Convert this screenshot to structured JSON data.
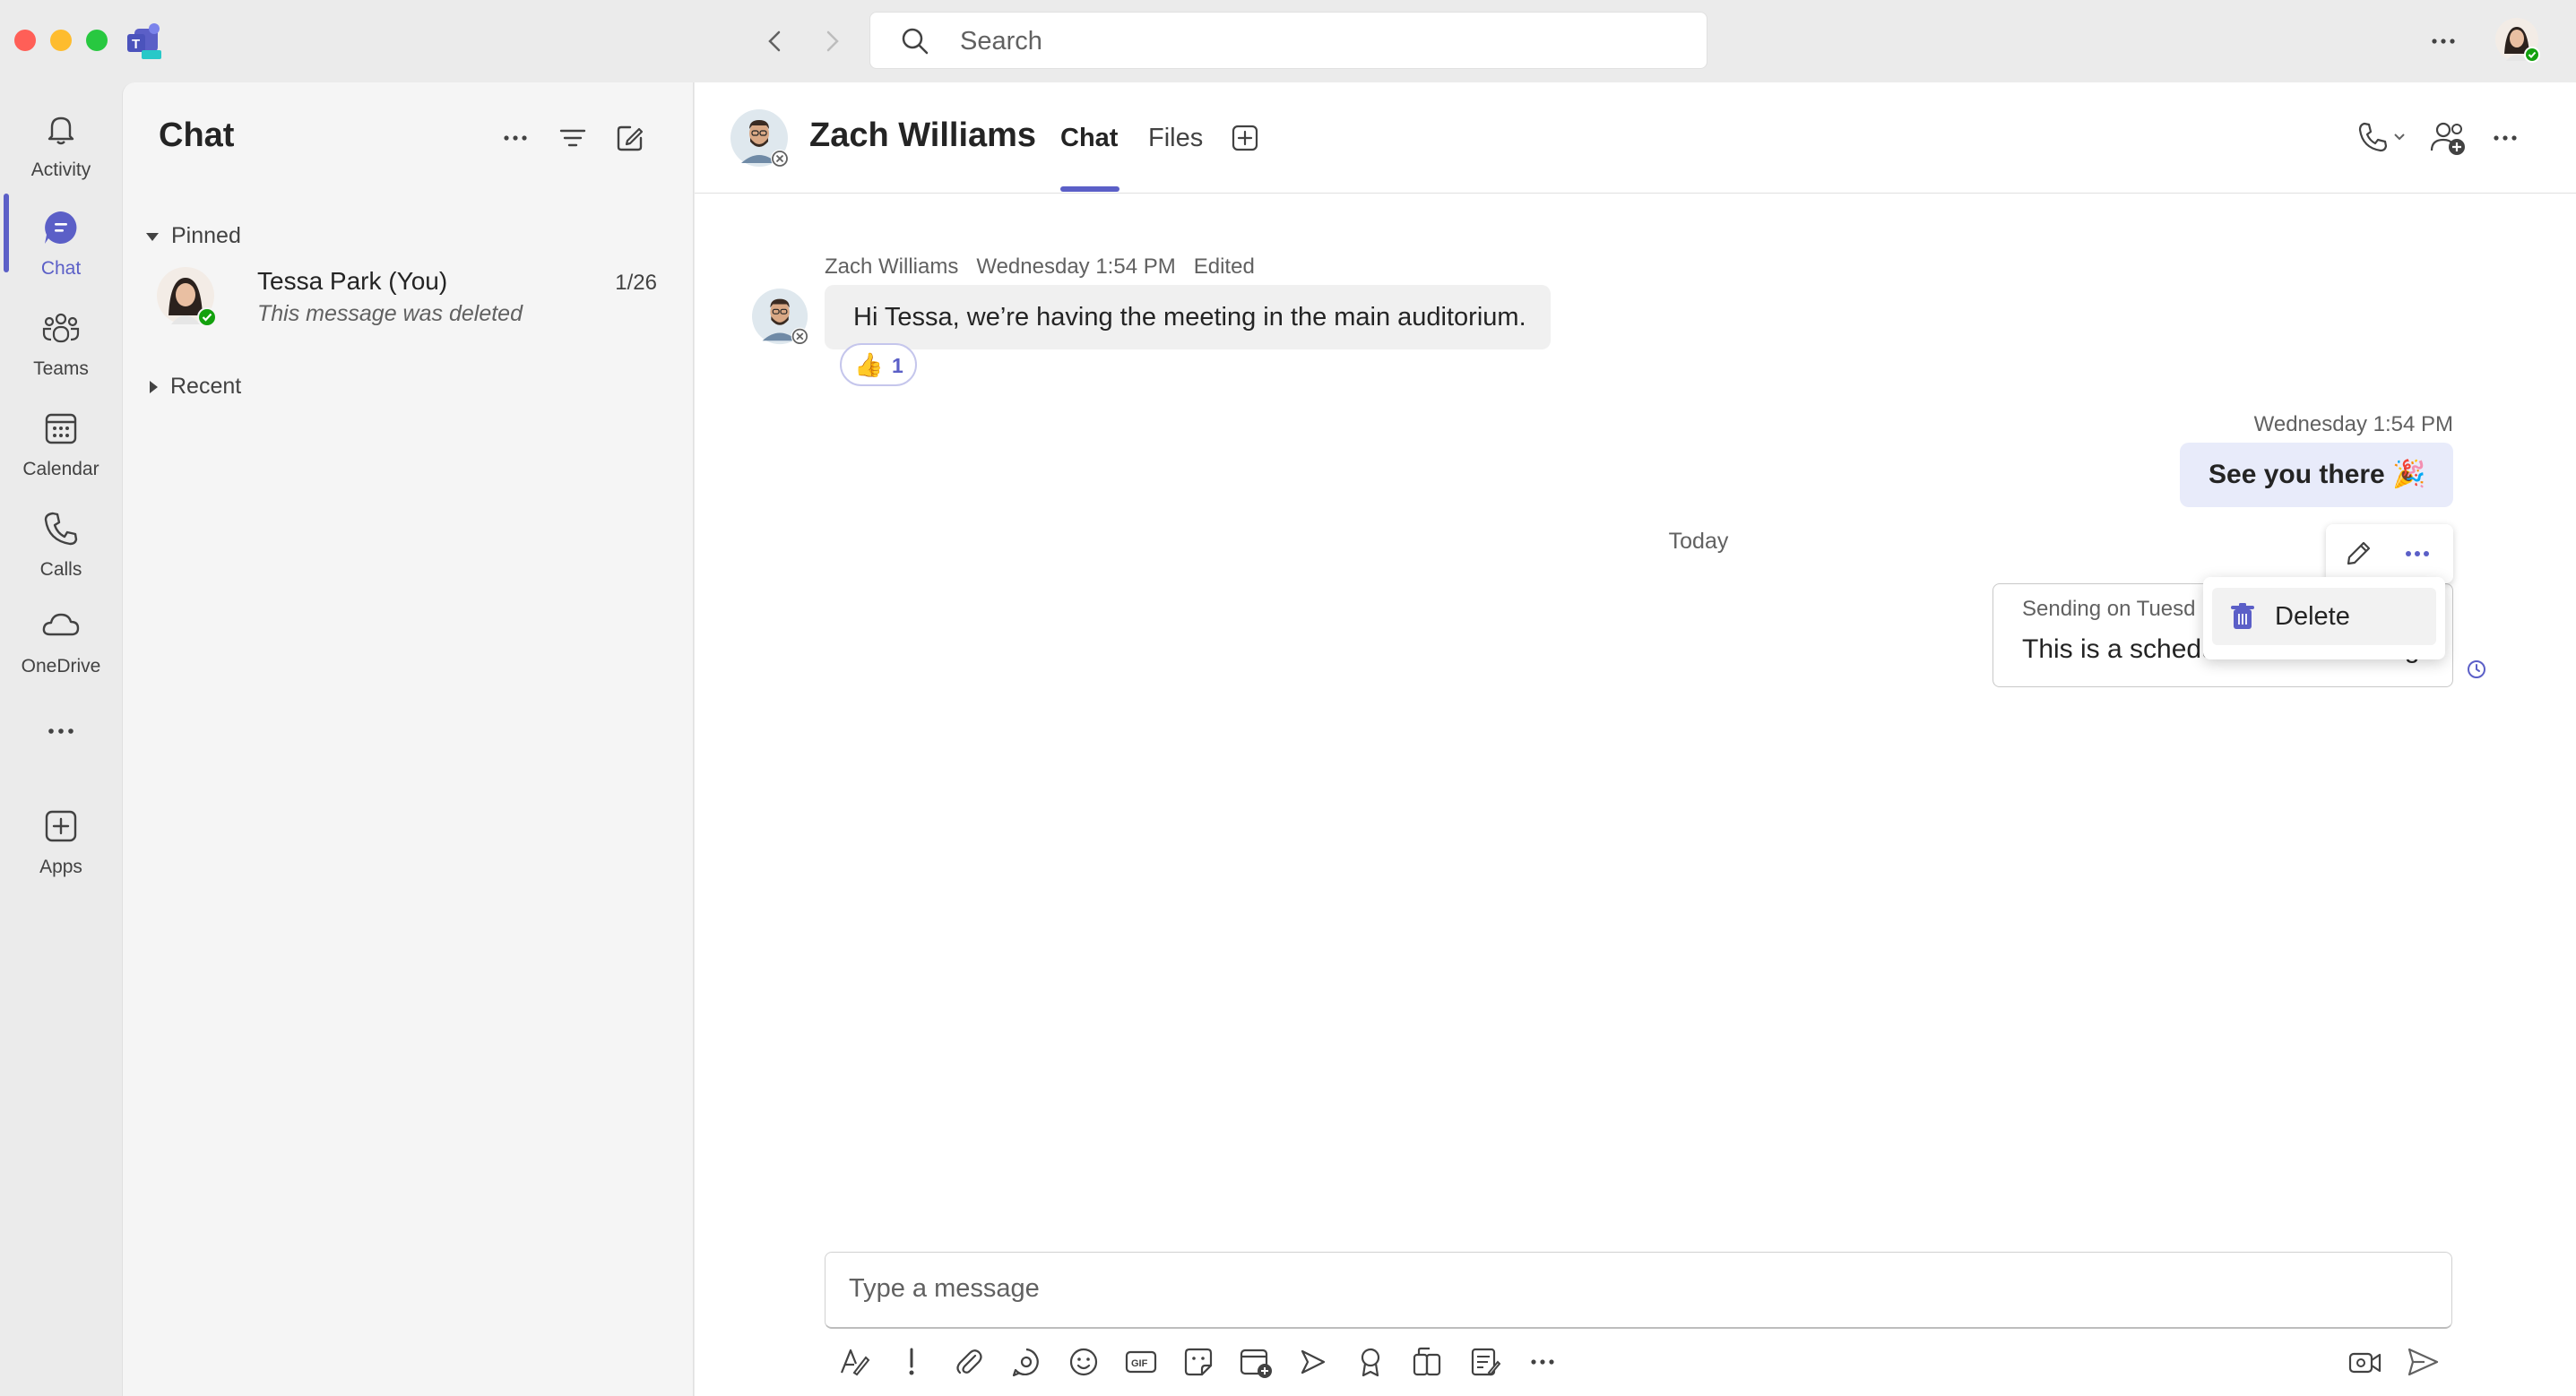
{
  "app": {
    "search_placeholder": "Search",
    "accent_color": "#5b5fc7",
    "status_online_color": "#13a10e"
  },
  "rail": {
    "items": [
      {
        "label": "Activity",
        "icon": "bell-icon"
      },
      {
        "label": "Chat",
        "icon": "chat-icon",
        "active": true
      },
      {
        "label": "Teams",
        "icon": "teams-icon"
      },
      {
        "label": "Calendar",
        "icon": "calendar-icon"
      },
      {
        "label": "Calls",
        "icon": "phone-icon"
      },
      {
        "label": "OneDrive",
        "icon": "cloud-icon"
      },
      {
        "label": "Apps",
        "icon": "add-app-icon"
      }
    ]
  },
  "chat_list": {
    "title": "Chat",
    "sections": {
      "pinned": "Pinned",
      "recent": "Recent"
    },
    "pinned_chats": [
      {
        "name": "Tessa Park (You)",
        "preview": "This message was deleted",
        "date": "1/26"
      }
    ]
  },
  "conversation": {
    "contact_name": "Zach Williams",
    "tabs": [
      "Chat",
      "Files"
    ],
    "active_tab": "Chat",
    "messages": {
      "incoming": {
        "sender": "Zach Williams",
        "time": "Wednesday 1:54 PM",
        "edited": "Edited",
        "text": "Hi Tessa, we’re having the meeting in the main auditorium.",
        "reaction_emoji": "👍",
        "reaction_count": "1"
      },
      "outgoing": {
        "time": "Wednesday 1:54 PM",
        "text": "See you there 🎉"
      },
      "divider": "Today",
      "scheduled": {
        "header": "Sending on Tuesd",
        "text": "This is a scheduled send message"
      }
    },
    "context_menu": {
      "delete_label": "Delete"
    },
    "composer": {
      "placeholder": "Type a message"
    }
  }
}
